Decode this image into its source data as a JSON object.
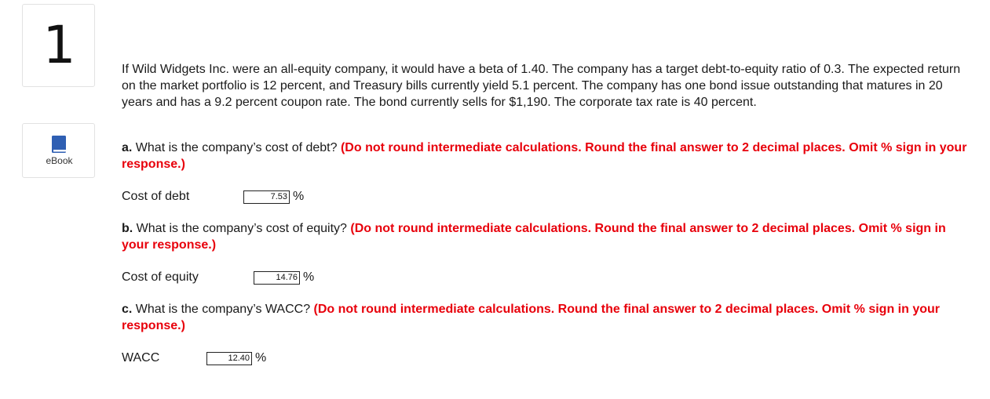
{
  "question": {
    "number": "1"
  },
  "sidebar": {
    "ebook_label": "eBook",
    "ebook_icon": "book-icon"
  },
  "problem": {
    "text": "If Wild Widgets Inc. were an all-equity company, it would have a beta of 1.40. The company has a target debt-to-equity ratio of 0.3. The expected return on the market portfolio is 12 percent, and Treasury bills currently yield 5.1 percent. The company has one bond issue outstanding that matures in 20 years and has a 9.2 percent coupon rate. The bond currently sells for $1,190. The corporate tax rate is 40 percent."
  },
  "parts": [
    {
      "letter": "a.",
      "question": " What is the company’s cost of debt? ",
      "instruction": "(Do not round intermediate calculations. Round the final answer to 2 decimal places. Omit % sign in your response.)",
      "answer_label": "Cost of debt",
      "answer_value": "7.53",
      "unit": "%"
    },
    {
      "letter": "b.",
      "question": " What is the company’s cost of equity? ",
      "instruction": "(Do not round intermediate calculations. Round the final answer to 2 decimal places. Omit % sign in your response.)",
      "answer_label": "Cost of equity",
      "answer_value": "14.76",
      "unit": "%"
    },
    {
      "letter": "c.",
      "question": " What is the company’s WACC? ",
      "instruction": "(Do not round intermediate calculations. Round the final answer to 2 decimal places. Omit % sign in your response.)",
      "answer_label": "WACC",
      "answer_value": "12.40",
      "unit": "%"
    }
  ],
  "colors": {
    "instruction_red": "#e8000b",
    "icon_blue": "#2f5fb3"
  }
}
